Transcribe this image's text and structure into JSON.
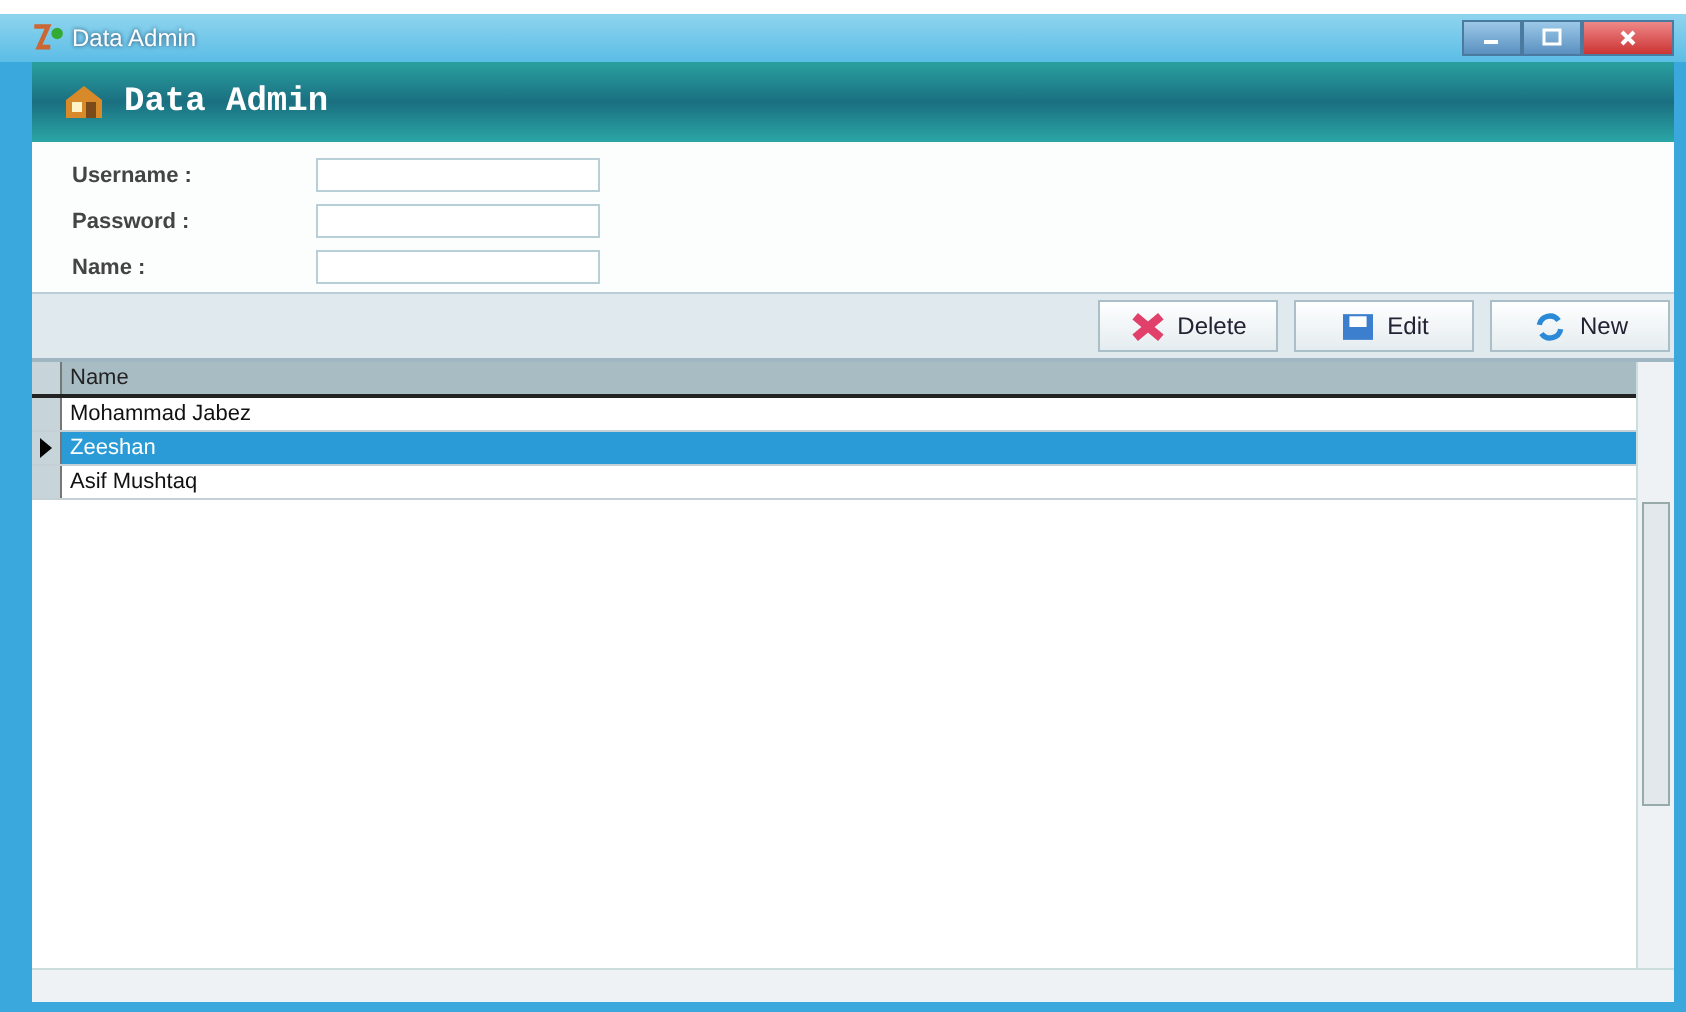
{
  "window": {
    "title": "Data Admin"
  },
  "header": {
    "title": "Data Admin"
  },
  "form": {
    "fields": [
      {
        "label": "Username :"
      },
      {
        "label": "Password :"
      },
      {
        "label": "Name :"
      }
    ]
  },
  "toolbar": {
    "buttons": [
      {
        "label": "Delete",
        "kind": "delete"
      },
      {
        "label": "Edit",
        "kind": "edit"
      },
      {
        "label": "New",
        "kind": "new"
      }
    ]
  },
  "table": {
    "columns": [
      "Name"
    ],
    "rows": [
      {
        "cells": [
          "Mohammad Jabez"
        ],
        "selected": false
      },
      {
        "cells": [
          "Zeeshan"
        ],
        "selected": true
      },
      {
        "cells": [
          "Asif Mushtaq"
        ],
        "selected": false
      }
    ]
  }
}
